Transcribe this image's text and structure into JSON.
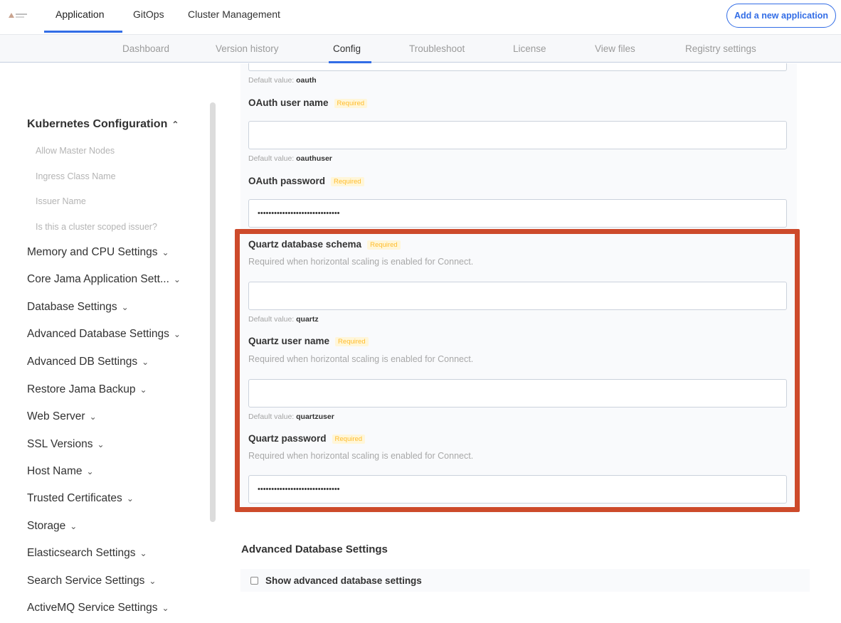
{
  "topnav": {
    "tabs": [
      {
        "label": "Application"
      },
      {
        "label": "GitOps"
      },
      {
        "label": "Cluster Management"
      }
    ],
    "add_button": "Add a new application"
  },
  "subnav": {
    "tabs": [
      {
        "label": "Dashboard"
      },
      {
        "label": "Version history"
      },
      {
        "label": "Config"
      },
      {
        "label": "Troubleshoot"
      },
      {
        "label": "License"
      },
      {
        "label": "View files"
      },
      {
        "label": "Registry settings"
      }
    ]
  },
  "sidebar": {
    "heading": "Kubernetes Configuration",
    "sub_items": [
      {
        "label": "Allow Master Nodes"
      },
      {
        "label": "Ingress Class Name"
      },
      {
        "label": "Issuer Name"
      },
      {
        "label": "Is this a cluster scoped issuer?"
      }
    ],
    "items": [
      {
        "label": "Memory and CPU Settings"
      },
      {
        "label": "Core Jama Application Sett..."
      },
      {
        "label": "Database Settings"
      },
      {
        "label": "Advanced Database Settings"
      },
      {
        "label": "Advanced DB Settings"
      },
      {
        "label": "Restore Jama Backup"
      },
      {
        "label": "Web Server"
      },
      {
        "label": "SSL Versions"
      },
      {
        "label": "Host Name"
      },
      {
        "label": "Trusted Certificates"
      },
      {
        "label": "Storage"
      },
      {
        "label": "Elasticsearch Settings"
      },
      {
        "label": "Search Service Settings"
      },
      {
        "label": "ActiveMQ Service Settings"
      }
    ]
  },
  "form": {
    "default_prefix": "Default value:",
    "required_badge": "Required",
    "oauth_default": "oauth",
    "oauth_user": {
      "label": "OAuth user name",
      "value": "",
      "default": "oauthuser"
    },
    "oauth_password": {
      "label": "OAuth password",
      "value": "••••••••••••••••••••••••••••••"
    },
    "quartz_schema": {
      "label": "Quartz database schema",
      "help": "Required when horizontal scaling is enabled for Connect.",
      "value": "",
      "default": "quartz"
    },
    "quartz_user": {
      "label": "Quartz user name",
      "help": "Required when horizontal scaling is enabled for Connect.",
      "value": "",
      "default": "quartzuser"
    },
    "quartz_password": {
      "label": "Quartz password",
      "help": "Required when horizontal scaling is enabled for Connect.",
      "value": "••••••••••••••••••••••••••••••"
    }
  },
  "advanced": {
    "title": "Advanced Database Settings",
    "checkbox_label": "Show advanced database settings"
  },
  "colors": {
    "accent": "#326de6",
    "highlight": "#cd4a2b",
    "required": "#ffbc2b"
  }
}
